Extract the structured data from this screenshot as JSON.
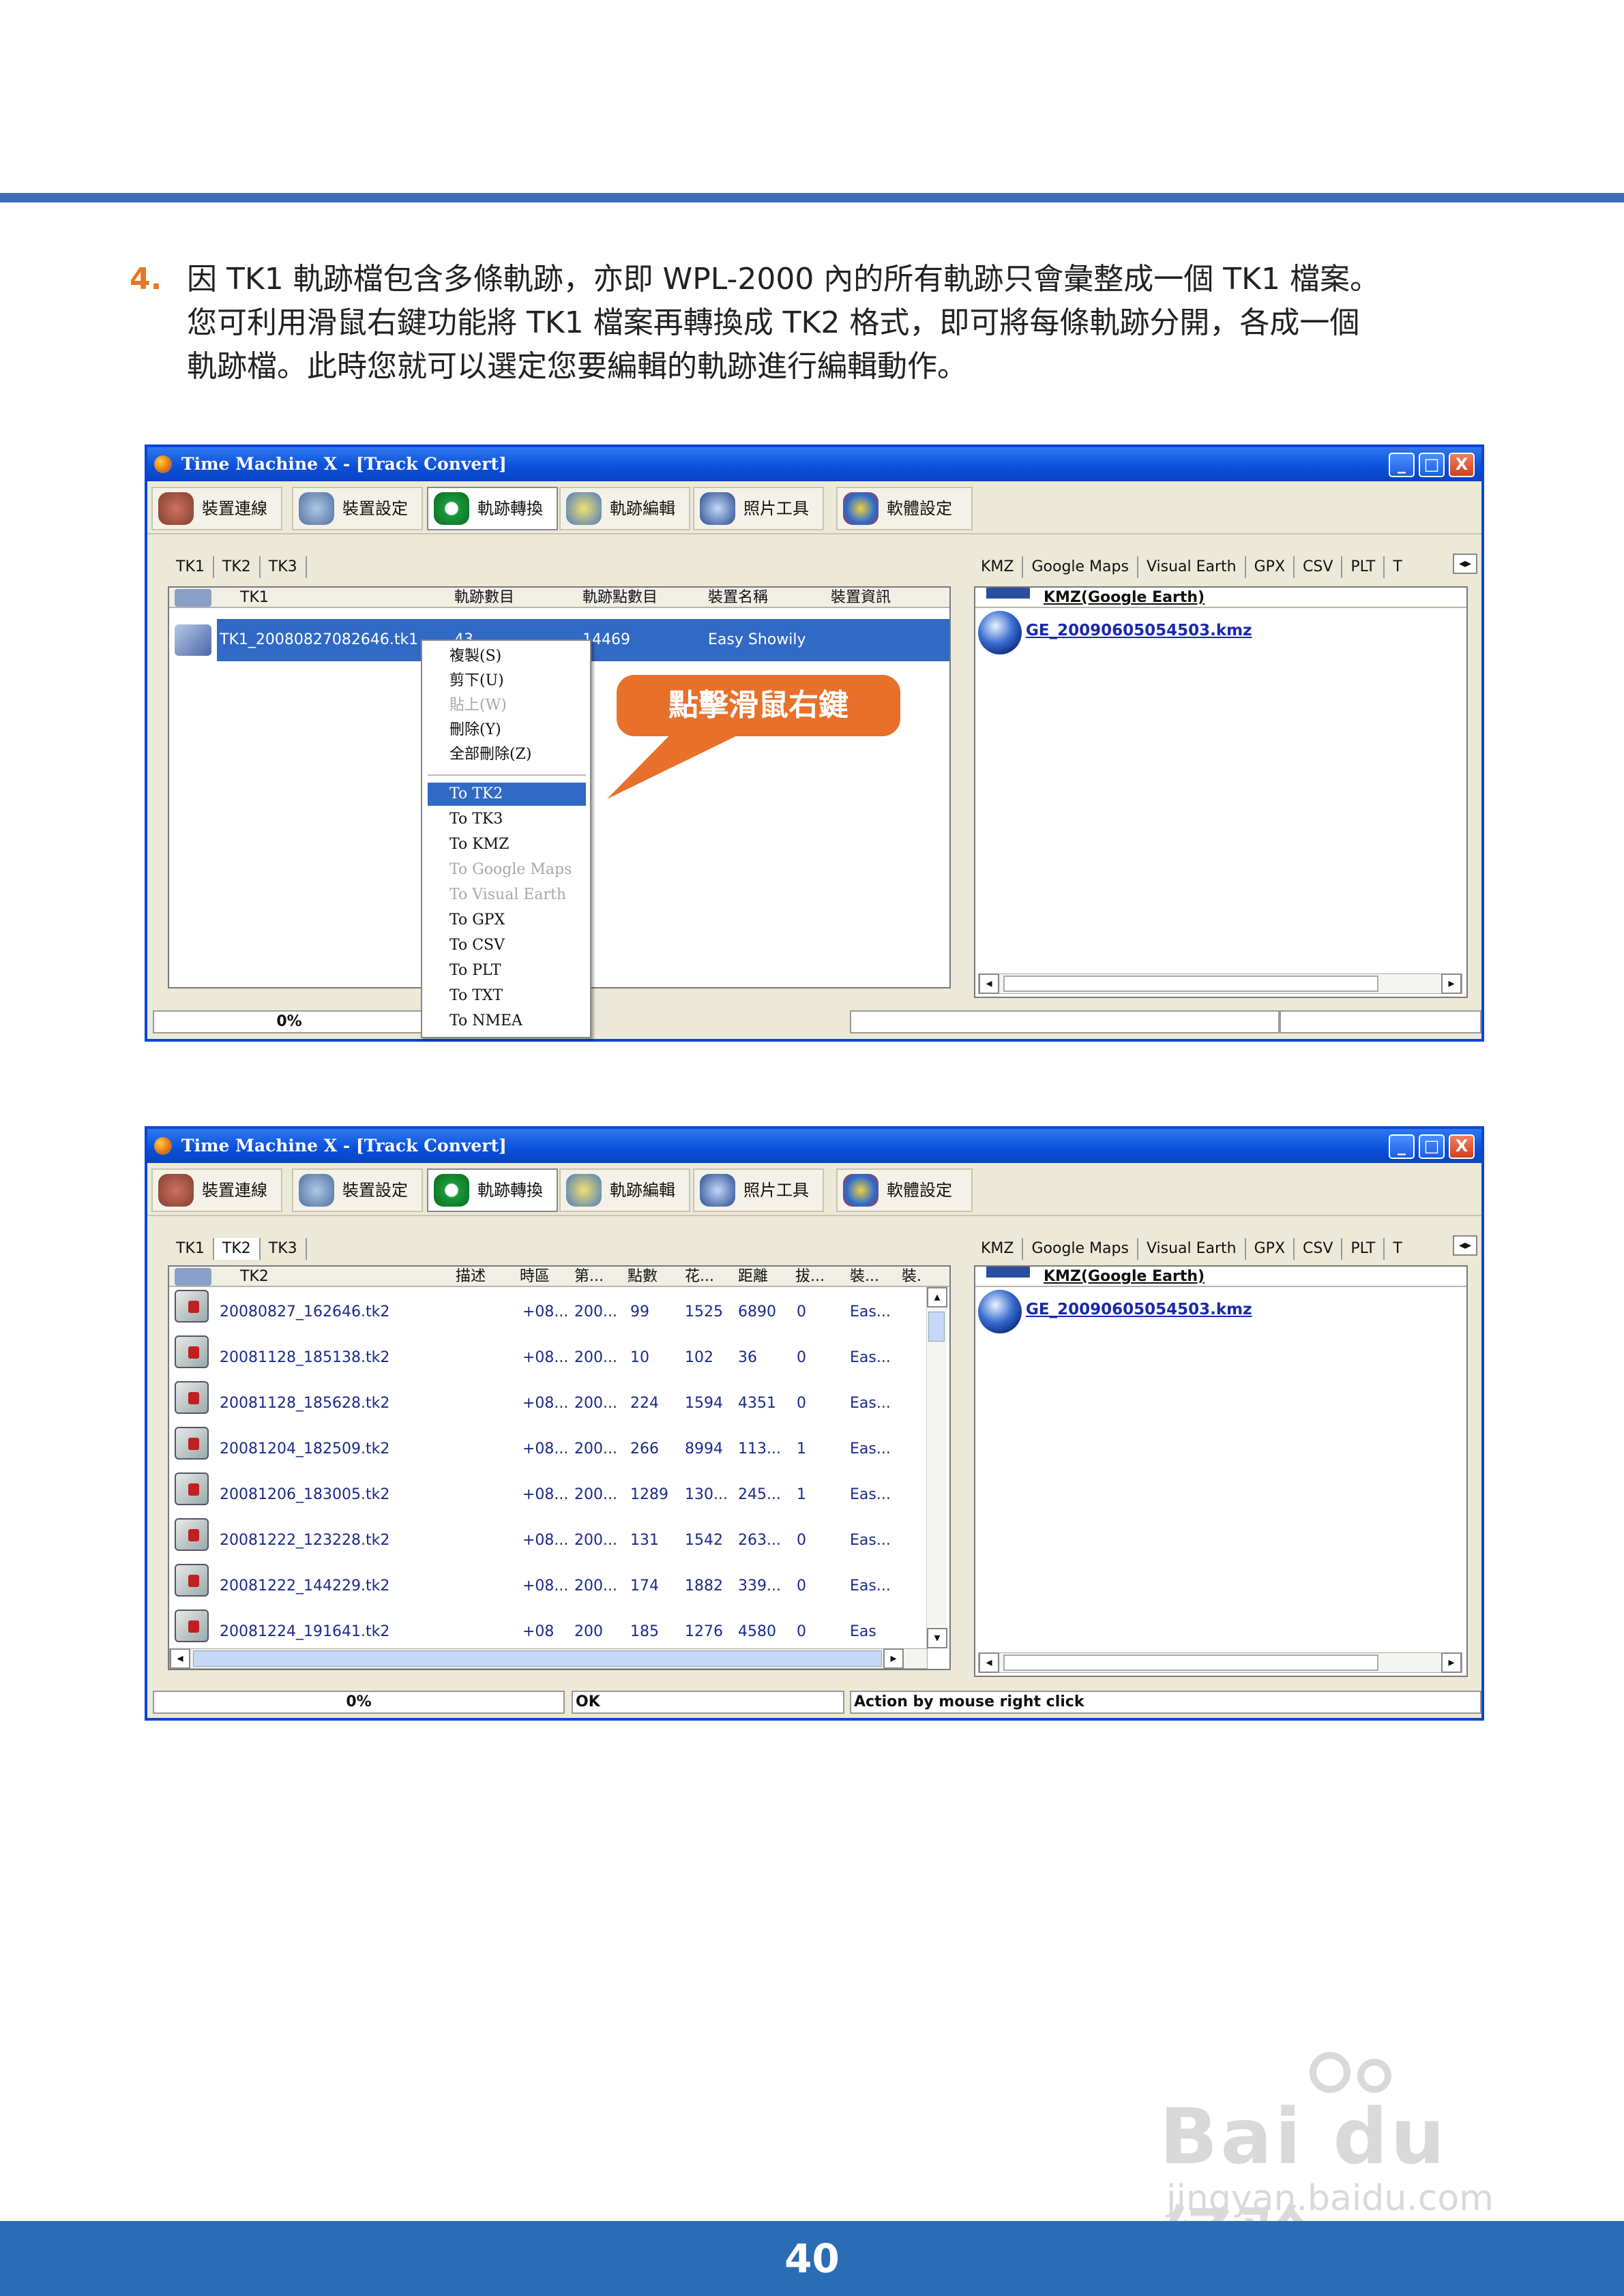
{
  "instruction": {
    "number": "4.",
    "lines": [
      "因 TK1 軌跡檔包含多條軌跡，亦即 WPL-2000 內的所有軌跡只會彙整成一個 TK1 檔案。",
      "您可利用滑鼠右鍵功能將 TK1 檔案再轉換成 TK2 格式，即可將每條軌跡分開，各成一個",
      "軌跡檔。此時您就可以選定您要編輯的軌跡進行編輯動作。"
    ]
  },
  "window1": {
    "title": "Time Machine X - [Track Convert]",
    "title_buttons": [
      "_",
      "□",
      "X"
    ],
    "toolbar": [
      "裝置連線",
      "裝置設定",
      "軌跡轉換",
      "軌跡編輯",
      "照片工具",
      "軟體設定"
    ],
    "left_tabs": [
      "TK1",
      "TK2",
      "TK3"
    ],
    "columns": [
      "TK1",
      "軌跡數目",
      "軌跡點數目",
      "裝置名稱",
      "裝置資訊"
    ],
    "row": {
      "name": "TK1_20080827082646.tk1",
      "tracks": "43",
      "points": "14469",
      "device": "Easy Showily",
      "info": ""
    },
    "right_tabs": [
      "KMZ",
      "Google Maps",
      "Visual Earth",
      "GPX",
      "CSV",
      "PLT",
      "T"
    ],
    "right_header": "KMZ(Google Earth)",
    "right_file": "GE_20090605054503.kmz",
    "progress": "0%",
    "menu": [
      {
        "label": "複製(S)",
        "state": "normal"
      },
      {
        "label": "剪下(U)",
        "state": "normal"
      },
      {
        "label": "貼上(W)",
        "state": "disabled"
      },
      {
        "label": "刪除(Y)",
        "state": "normal"
      },
      {
        "label": "全部刪除(Z)",
        "state": "normal"
      },
      {
        "label": "To TK2",
        "state": "highlight"
      },
      {
        "label": "To TK3",
        "state": "normal"
      },
      {
        "label": "To KMZ",
        "state": "normal"
      },
      {
        "label": "To Google Maps",
        "state": "disabled"
      },
      {
        "label": "To Visual Earth",
        "state": "disabled"
      },
      {
        "label": "To GPX",
        "state": "normal"
      },
      {
        "label": "To CSV",
        "state": "normal"
      },
      {
        "label": "To PLT",
        "state": "normal"
      },
      {
        "label": "To TXT",
        "state": "normal"
      },
      {
        "label": "To NMEA",
        "state": "normal"
      }
    ],
    "callout": "點擊滑鼠右鍵"
  },
  "window2": {
    "title": "Time Machine X - [Track Convert]",
    "title_buttons": [
      "_",
      "□",
      "X"
    ],
    "toolbar": [
      "裝置連線",
      "裝置設定",
      "軌跡轉換",
      "軌跡編輯",
      "照片工具",
      "軟體設定"
    ],
    "left_tabs": [
      "TK1",
      "TK2",
      "TK3"
    ],
    "columns": [
      "TK2",
      "描述",
      "時區",
      "第...",
      "點數",
      "花...",
      "距離",
      "拔...",
      "裝...",
      "裝."
    ],
    "rows": [
      [
        "20080827_162646.tk2",
        "",
        "+08...",
        "200...",
        "99",
        "1525",
        "6890",
        "0",
        "Eas..."
      ],
      [
        "20081128_185138.tk2",
        "",
        "+08...",
        "200...",
        "10",
        "102",
        "36",
        "0",
        "Eas..."
      ],
      [
        "20081128_185628.tk2",
        "",
        "+08...",
        "200...",
        "224",
        "1594",
        "4351",
        "0",
        "Eas..."
      ],
      [
        "20081204_182509.tk2",
        "",
        "+08...",
        "200...",
        "266",
        "8994",
        "113...",
        "1",
        "Eas..."
      ],
      [
        "20081206_183005.tk2",
        "",
        "+08...",
        "200...",
        "1289",
        "130...",
        "245...",
        "1",
        "Eas..."
      ],
      [
        "20081222_123228.tk2",
        "",
        "+08...",
        "200...",
        "131",
        "1542",
        "263...",
        "0",
        "Eas..."
      ],
      [
        "20081222_144229.tk2",
        "",
        "+08...",
        "200...",
        "174",
        "1882",
        "339...",
        "0",
        "Eas..."
      ],
      [
        "20081224_191641.tk2",
        "",
        "+08",
        "200",
        "185",
        "1276",
        "4580",
        "0",
        "Eas"
      ]
    ],
    "right_tabs": [
      "KMZ",
      "Google Maps",
      "Visual Earth",
      "GPX",
      "CSV",
      "PLT",
      "T"
    ],
    "right_header": "KMZ(Google Earth)",
    "right_file": "GE_20090605054503.kmz",
    "progress": "0%",
    "status_ok": "OK",
    "status_action": "Action by mouse right click"
  },
  "watermark": {
    "brand": "Bai du 经验",
    "url": "jingyan.baidu.com"
  },
  "page_number": "40"
}
